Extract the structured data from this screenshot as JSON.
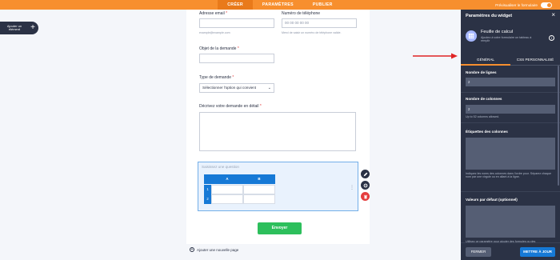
{
  "topbar": {
    "tabs": [
      {
        "label": "CRÉER",
        "active": true
      },
      {
        "label": "PARAMÈTRES",
        "active": false
      },
      {
        "label": "PUBLIER",
        "active": false
      }
    ],
    "preview_label": "Prévisualiser le formulaire"
  },
  "sidebar": {
    "add_element_label": "Ajouter un élément",
    "add_icon": "+"
  },
  "form": {
    "email": {
      "label": "Adresse email",
      "req": "*",
      "hint": "example@example.com"
    },
    "phone": {
      "label": "Numéro de téléphone",
      "placeholder": "00 00 00 00 00",
      "hint": "Merci de saisir un numéro de téléphone valide."
    },
    "subject": {
      "label": "Objet de la demande",
      "req": "*"
    },
    "type": {
      "label": "Type de demande",
      "req": "*",
      "selected": "Sélectionner l'option qui convient",
      "caret": "⌄"
    },
    "details": {
      "label": "Décrivez votre demande en détail",
      "req": "*"
    },
    "spreadsheet": {
      "question_placeholder": "Saisissez une question",
      "columns": [
        "A",
        "B"
      ],
      "rows": [
        "1",
        "2"
      ]
    },
    "submit_label": "Envoyer",
    "add_page_icon": "+",
    "add_page_label": "Ajouter une nouvelle page"
  },
  "panel": {
    "title": "Paramètres du widget",
    "close_icon": "×",
    "widget_name": "Feuille de calcul",
    "widget_desc": "Ajoutez à votre formulaire un tableau à remplir",
    "info_icon": "i",
    "tabs": [
      {
        "label": "GÉNÉRAL",
        "active": true
      },
      {
        "label": "CSS PERSONNALISÉ",
        "active": false
      }
    ],
    "rows_label": "Nombre de lignes",
    "rows_value": "2",
    "cols_label": "Nombre de colonnes",
    "cols_value": "2",
    "cols_hint": "Up to 52 columns allowed.",
    "col_labels_label": "Étiquettes des colonnes",
    "col_labels_hint": "Indiquez les noms des colonnes dans l'ordre pour. Séparez chaque nom par une virgule ou en allant à la ligne.",
    "defaults_label": "Valeurs par défaut (optionnel)",
    "defaults_hint": "Utilisez ce paramètre pour ajouter des formules ou des",
    "btn_close": "FERMER",
    "btn_update": "METTRE À JOUR"
  },
  "colors": {
    "accent_orange": "#f78f2e",
    "panel_dark": "#2b3245",
    "blue": "#1679d6",
    "green": "#2dbf5c",
    "arrow_red": "#e02424"
  }
}
